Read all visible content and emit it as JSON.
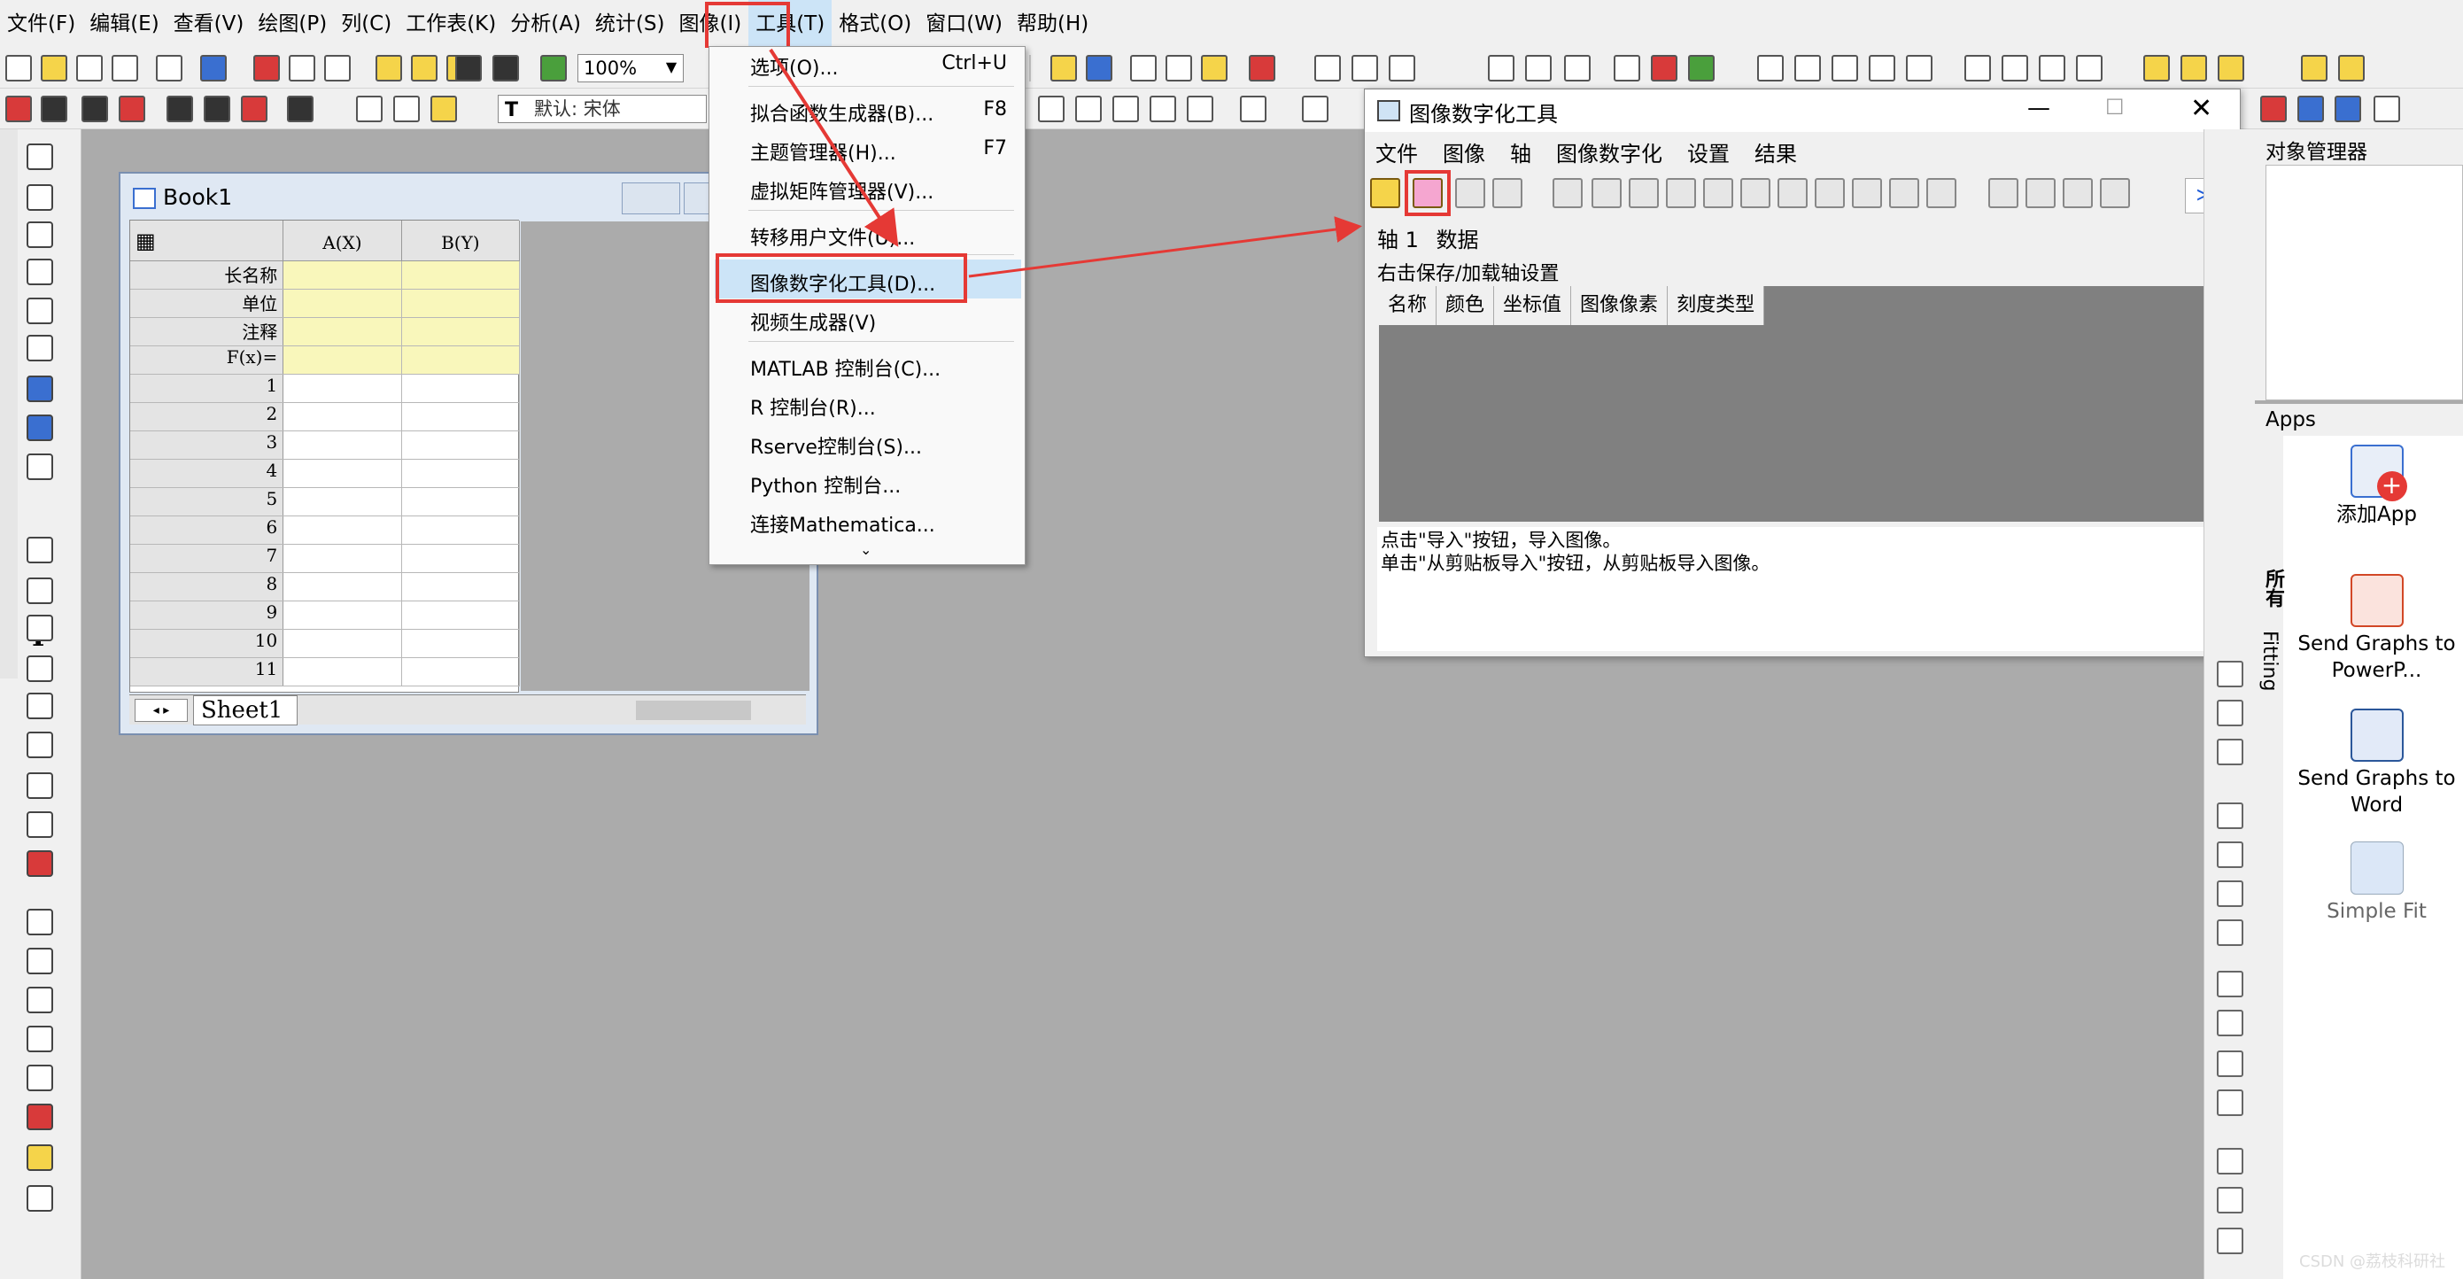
{
  "menubar": {
    "items": [
      "文件(F)",
      "编辑(E)",
      "查看(V)",
      "绘图(P)",
      "列(C)",
      "工作表(K)",
      "分析(A)",
      "统计(S)",
      "图像(I)",
      "工具(T)",
      "格式(O)",
      "窗口(W)",
      "帮助(H)"
    ],
    "active": "工具(T)"
  },
  "toolbar": {
    "zoom_value": "100%",
    "font_value": "默认: 宋体"
  },
  "book": {
    "title": "Book1",
    "columns": [
      "A(X)",
      "B(Y)"
    ],
    "meta_rows": [
      "长名称",
      "单位",
      "注释",
      "F(x)="
    ],
    "row_numbers": [
      "1",
      "2",
      "3",
      "4",
      "5",
      "6",
      "7",
      "8",
      "9",
      "10",
      "11"
    ],
    "sheet_tab": "Sheet1"
  },
  "tools_menu": {
    "items": [
      {
        "label": "选项(O)...",
        "shortcut": "Ctrl+U"
      },
      {
        "label": "拟合函数生成器(B)...",
        "shortcut": "F8"
      },
      {
        "label": "主题管理器(H)...",
        "shortcut": "F7"
      },
      {
        "label": "虚拟矩阵管理器(V)...",
        "shortcut": ""
      },
      {
        "label": "转移用户文件(U)...",
        "shortcut": ""
      },
      {
        "label": "图像数字化工具(D)...",
        "shortcut": ""
      },
      {
        "label": "视频生成器(V)",
        "shortcut": ""
      },
      {
        "label": "MATLAB 控制台(C)...",
        "shortcut": ""
      },
      {
        "label": "R 控制台(R)...",
        "shortcut": ""
      },
      {
        "label": "Rserve控制台(S)...",
        "shortcut": ""
      },
      {
        "label": "Python 控制台...",
        "shortcut": ""
      },
      {
        "label": "连接Mathematica...",
        "shortcut": ""
      }
    ],
    "highlighted": "图像数字化工具(D)...",
    "more_glyph": "⌄"
  },
  "digitizer": {
    "title": "图像数字化工具",
    "menu": [
      "文件",
      "图像",
      "轴",
      "图像数字化",
      "设置",
      "结果"
    ],
    "tabs": [
      "轴 1",
      "数据"
    ],
    "hint": "右击保存/加载轴设置",
    "table_headers": [
      "名称",
      "颜色",
      "坐标值",
      "图像像素",
      "刻度类型"
    ],
    "log_lines": [
      "点击\"导入\"按钮，导入图像。",
      "单击\"从剪贴板导入\"按钮，从剪贴板导入图像。"
    ],
    "expand_glyph": "≫"
  },
  "object_manager": {
    "title": "对象管理器"
  },
  "apps": {
    "title": "Apps",
    "side_tabs": [
      "所有",
      "Fitting"
    ],
    "items": [
      {
        "label": "添加App",
        "icon": "add-app-icon"
      },
      {
        "label": "Send Graphs to PowerP...",
        "icon": "powerpoint-icon"
      },
      {
        "label": "Send Graphs to Word",
        "icon": "word-icon"
      },
      {
        "label": "Simple Fit",
        "icon": "simple-fit-icon"
      }
    ]
  },
  "watermark": "CSDN @荔枝科研社",
  "colors": {
    "highlight_red": "#e53935",
    "meta_yellow": "#f9f7bb",
    "menu_highlight": "#cce4f7"
  }
}
